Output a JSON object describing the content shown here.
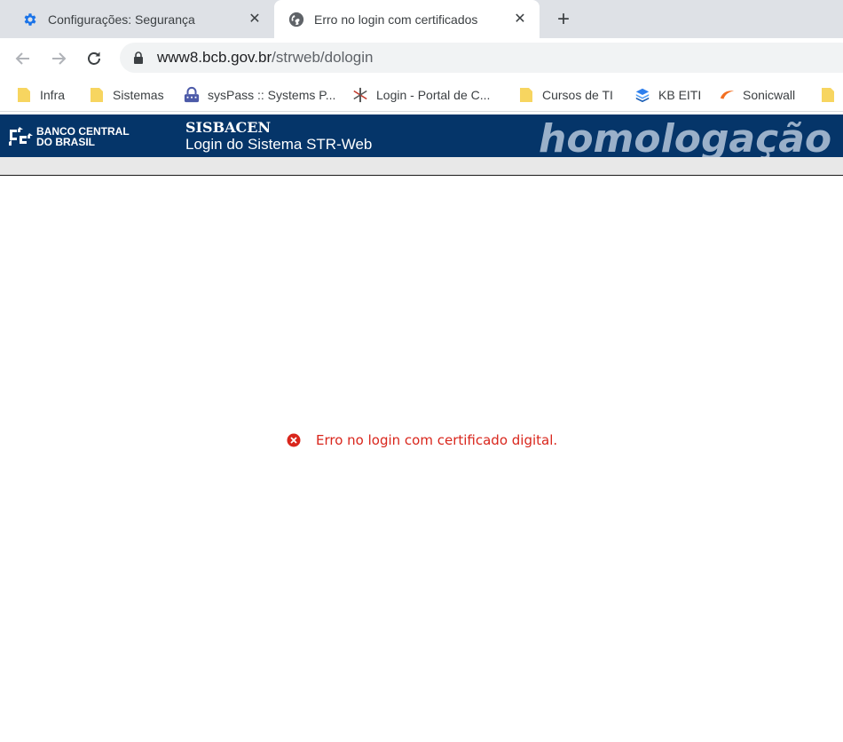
{
  "browser": {
    "tabs": [
      {
        "title": "Configurações: Segurança",
        "icon": "gear-icon",
        "active": false
      },
      {
        "title": "Erro no login com certificados",
        "icon": "globe-icon",
        "active": true
      }
    ],
    "address": {
      "host": "www8.bcb.gov.br",
      "path": "/strweb/dologin"
    },
    "bookmarks": [
      {
        "label": "Infra",
        "icon": "folder-icon"
      },
      {
        "label": "Sistemas",
        "icon": "folder-icon"
      },
      {
        "label": "sysPass :: Systems P...",
        "icon": "syspass-icon"
      },
      {
        "label": "Login - Portal de C...",
        "icon": "asterisk-logo-icon"
      },
      {
        "label": "Cursos de TI",
        "icon": "folder-icon"
      },
      {
        "label": "KB EITI",
        "icon": "stack-icon"
      },
      {
        "label": "Sonicwall",
        "icon": "swoosh-icon"
      }
    ]
  },
  "header": {
    "logo_line1": "BANCO CENTRAL",
    "logo_line2": "DO BRASIL",
    "system": "SISBACEN",
    "subtitle": "Login do Sistema STR-Web",
    "environment": "homologação"
  },
  "error": {
    "message": "Erro no login com certificado digital.",
    "icon": "error-circle-icon",
    "color": "#d9261c"
  },
  "colors": {
    "banner": "#053569",
    "tabstrip": "#dee1e6",
    "folder": "#f7d560"
  }
}
